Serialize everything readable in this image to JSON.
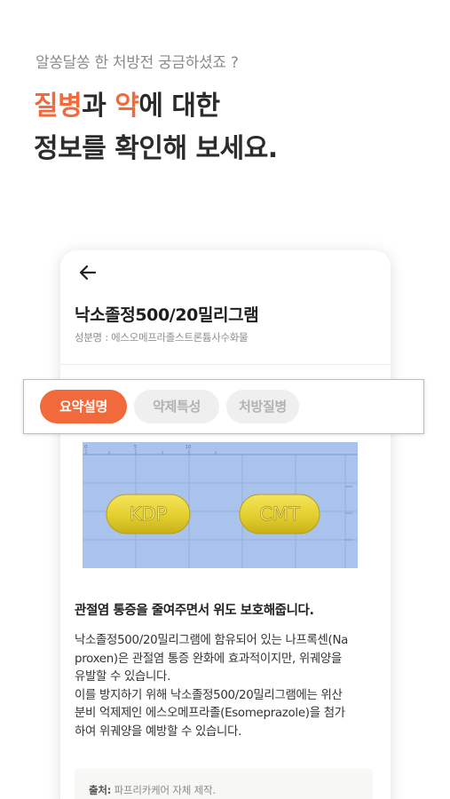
{
  "promo": {
    "subtitle": "알쏭달쏭 한 처방전 궁금하셨죠 ?",
    "title_highlight_1": "질병",
    "title_text_1": "과 ",
    "title_highlight_2": "약",
    "title_text_2": "에 대한",
    "title_line_2": "정보를 확인해 보세요."
  },
  "screen": {
    "drug_name": "낙소졸정500/20밀리그램",
    "ingredient": "성분명 : 에스오메프라졸스트론튬사수화물",
    "tabs": [
      {
        "label": "요약설명",
        "active": true
      },
      {
        "label": "약제특성",
        "active": false
      },
      {
        "label": "처방질병",
        "active": false
      }
    ],
    "pill_imprints": [
      "KDP",
      "CMT"
    ],
    "summary_title": "관절염 통증을 줄여주면서 위도 보호해줍니다.",
    "summary_lines": [
      "낙소졸정500/20밀리그램에 함유되어 있는 나프록센(Na",
      "proxen)은 관절염 통증 완화에 효과적이지만, 위궤양을",
      "유발할 수 있습니다.",
      "이를 방지하기 위해 낙소졸정500/20밀리그램에는 위산",
      "분비 억제제인 에스오메프라졸(Esomeprazole)을 첨가",
      "하여 위궤양을 예방할 수 있습니다."
    ],
    "source_label": "출처:",
    "source_text": " 파프리카케어 자체 제작."
  },
  "colors": {
    "accent": "#f26a3b",
    "pill": "#e9d63a",
    "photo_bg": "#a9c3ec"
  }
}
